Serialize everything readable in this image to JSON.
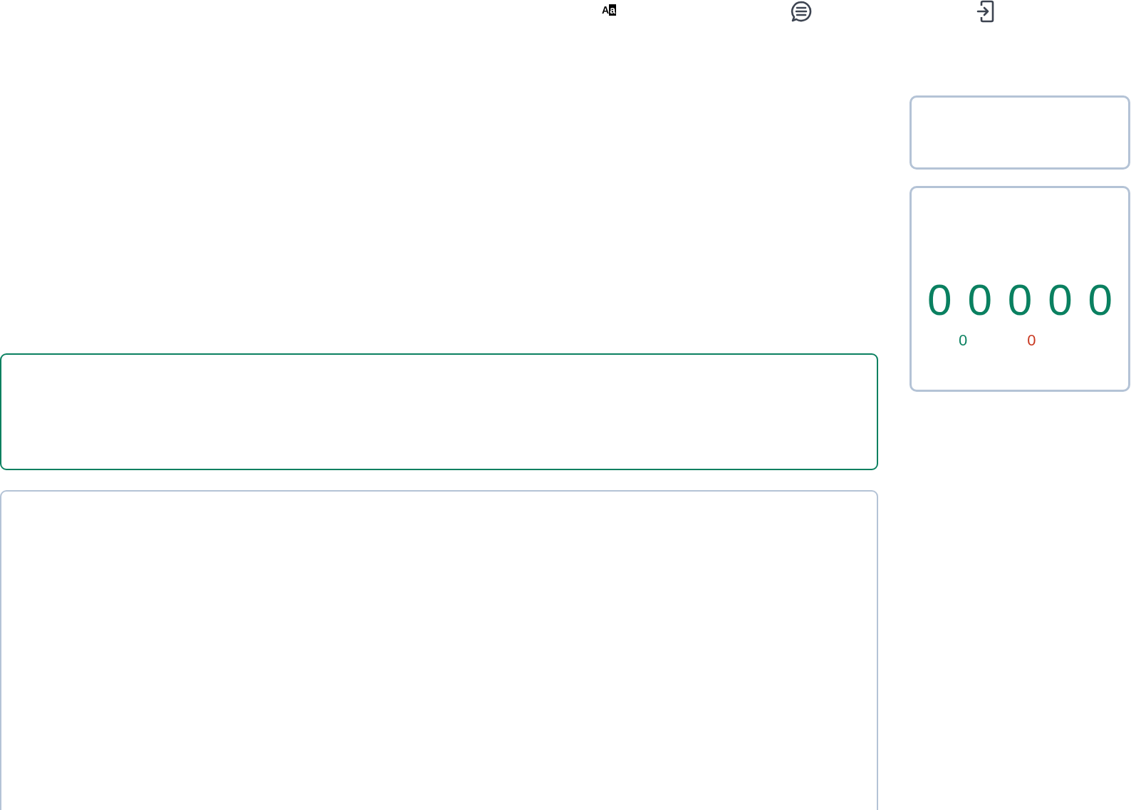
{
  "toolbar": {
    "font_icon_letters": [
      "A",
      "a"
    ]
  },
  "score_panel": {
    "digits": [
      "0",
      "0",
      "0",
      "0",
      "0"
    ],
    "counters": [
      {
        "value": "0",
        "color": "#0a8060"
      },
      {
        "value": "0",
        "color": "#c8361e"
      }
    ]
  }
}
